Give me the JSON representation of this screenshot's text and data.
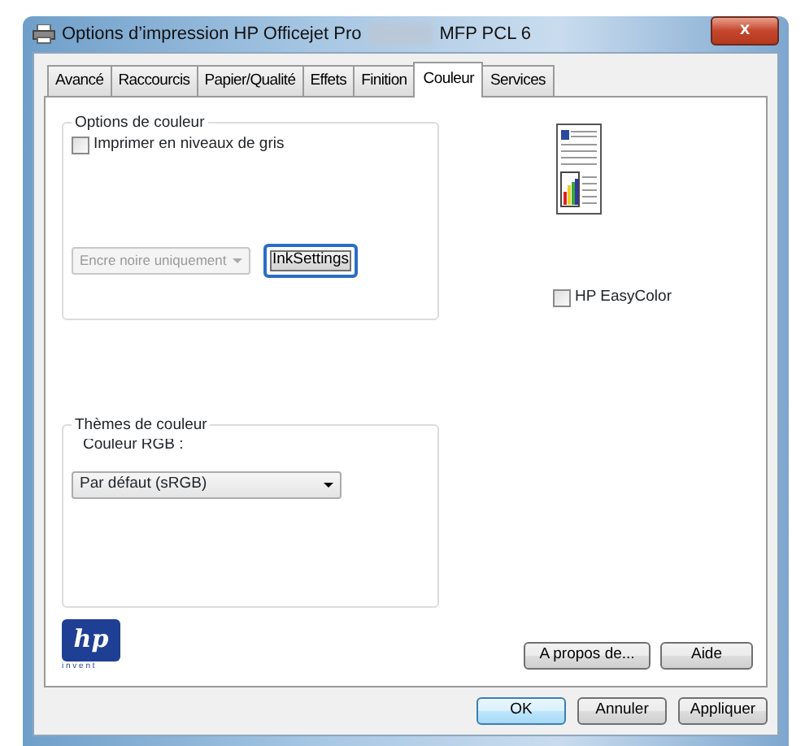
{
  "window": {
    "title_start": "Options d’impression HP Officejet Pro",
    "title_end": "MFP PCL 6",
    "close": "x"
  },
  "tabs": [
    {
      "label": "Avancé",
      "selected": false
    },
    {
      "label": "Raccourcis",
      "selected": false
    },
    {
      "label": "Papier/Qualité",
      "selected": false
    },
    {
      "label": "Effets",
      "selected": false
    },
    {
      "label": "Finition",
      "selected": false
    },
    {
      "label": "Couleur",
      "selected": true
    },
    {
      "label": "Services",
      "selected": false
    }
  ],
  "color_options": {
    "title": "Options de couleur",
    "grayscale": {
      "label": "Imprimer en niveaux de gris",
      "checked": false
    },
    "ink_select": {
      "value": "Encre noire uniquement",
      "disabled": true
    },
    "ink_button": {
      "label": "InkSettings",
      "focused": true
    }
  },
  "easycolor": {
    "label": "HP EasyColor",
    "checked": false
  },
  "color_themes": {
    "title": "Thèmes de couleur",
    "rgb_label": "Couleur RGB :",
    "rgb_select": {
      "value": "Par défaut (sRGB)",
      "disabled": false
    }
  },
  "logo": {
    "mark": "hp",
    "tagline": "i n v e n t"
  },
  "panel_buttons": [
    "A propos de...",
    "Aide"
  ],
  "dialog_buttons": [
    {
      "label": "OK",
      "default": true
    },
    {
      "label": "Annuler",
      "default": false
    },
    {
      "label": "Appliquer",
      "default": false
    }
  ]
}
